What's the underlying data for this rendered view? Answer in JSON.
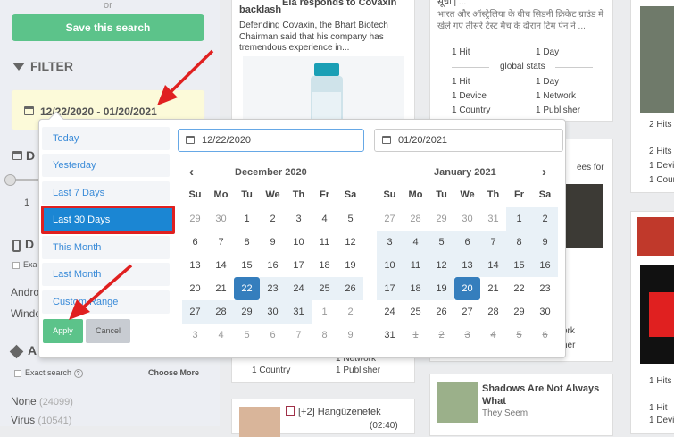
{
  "sidebar": {
    "or": "or",
    "save_label": "Save this search",
    "filter_title": "FILTER",
    "date_range": "12/22/2020 - 01/20/2021",
    "frag_d1": "D",
    "frag_d2": "D",
    "frag_1": "1",
    "frag_exa": "Exa",
    "frag_andro": "Andro",
    "frag_windo": "Windo",
    "frag_a": "A",
    "exact_search": "Exact search",
    "choose_more": "Choose More",
    "none_label": "None",
    "none_count": "(24099)",
    "virus_label": "Virus",
    "virus_count": "(10541)"
  },
  "cards": {
    "c1_title": "backlash",
    "c1_title_top": "Ela responds to Covaxin",
    "c1_body": "Defending Covaxin, the Bhart Biotech Chairman said that his company has tremendous experience in...",
    "c2_top": "सूची | ...",
    "c2_body": "भारत और ऑस्ट्रेलिया के बीच सिडनी क्रिकेट ग्राउंड में खेले गए तीसरे टेस्ट मैच के दौरान टिम पेन ने ...",
    "c2_hit": "1 Hit",
    "c2_day": "1 Day",
    "c2_global": "global stats",
    "c2_hit2": "1 Hit",
    "c2_day2": "1 Day",
    "c2_device": "1 Device",
    "c2_network": "1 Network",
    "c2_country": "1 Country",
    "c2_publisher": "1 Publisher",
    "c3_fees": "ees for",
    "c3_work": "ork",
    "c3_her": "her",
    "c4_country": "1 Country",
    "c4_publisher": "1 Publisher",
    "c4_network": "1 Network",
    "c5_title": "[+2] Hangüzenetek",
    "c5_time": "(02:40)",
    "c6_title": "Shadows Are Not Always What",
    "c6_sub": "They Seem",
    "r1": "2 Hits",
    "r2": "2 Hits",
    "r3": "1 Devic",
    "r4": "1 Coun",
    "r5": "1 Hits",
    "r6": "1 Hit",
    "r7": "1 Devi"
  },
  "picker": {
    "ranges": [
      "Today",
      "Yesterday",
      "Last 7 Days",
      "Last 30 Days",
      "This Month",
      "Last Month",
      "Custom Range"
    ],
    "active_range": "Last 30 Days",
    "apply": "Apply",
    "cancel": "Cancel",
    "start_input": "12/22/2020",
    "end_input": "01/20/2021",
    "left_month": "December 2020",
    "right_month": "January 2021",
    "dow": [
      "Su",
      "Mo",
      "Tu",
      "We",
      "Th",
      "Fr",
      "Sa"
    ],
    "left_days": [
      [
        "29",
        "30",
        "1",
        "2",
        "3",
        "4",
        "5"
      ],
      [
        "6",
        "7",
        "8",
        "9",
        "10",
        "11",
        "12"
      ],
      [
        "13",
        "14",
        "15",
        "16",
        "17",
        "18",
        "19"
      ],
      [
        "20",
        "21",
        "22",
        "23",
        "24",
        "25",
        "26"
      ],
      [
        "27",
        "28",
        "29",
        "30",
        "31",
        "1",
        "2"
      ],
      [
        "3",
        "4",
        "5",
        "6",
        "7",
        "8",
        "9"
      ]
    ],
    "right_days": [
      [
        "27",
        "28",
        "29",
        "30",
        "31",
        "1",
        "2"
      ],
      [
        "3",
        "4",
        "5",
        "6",
        "7",
        "8",
        "9"
      ],
      [
        "10",
        "11",
        "12",
        "13",
        "14",
        "15",
        "16"
      ],
      [
        "17",
        "18",
        "19",
        "20",
        "21",
        "22",
        "23"
      ],
      [
        "24",
        "25",
        "26",
        "27",
        "28",
        "29",
        "30"
      ],
      [
        "31",
        "1",
        "2",
        "3",
        "4",
        "5",
        "6"
      ]
    ]
  },
  "colors": {
    "accent": "#357ebd",
    "green": "#5cc38a",
    "highlight_red": "#e02020",
    "range_bg": "#e9f1f7"
  }
}
